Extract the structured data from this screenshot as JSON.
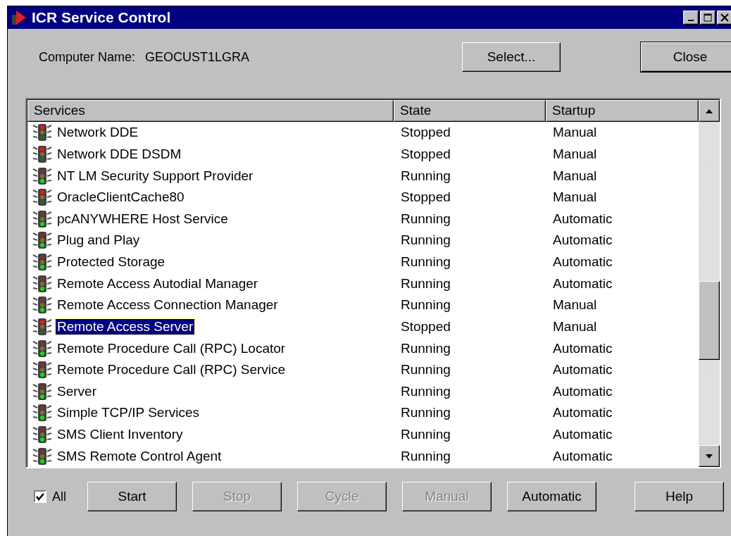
{
  "window": {
    "title": "ICR Service Control"
  },
  "computer": {
    "label": "Computer Name:",
    "value": "GEOCUST1LGRA"
  },
  "top_buttons": [
    {
      "label": "Select..."
    },
    {
      "label": "Close",
      "default": true
    }
  ],
  "table": {
    "columns": [
      "Services",
      "State",
      "Startup"
    ],
    "rows": [
      {
        "name": "Network DDE",
        "state": "Stopped",
        "startup": "Manual",
        "running": false,
        "selected": false
      },
      {
        "name": "Network DDE DSDM",
        "state": "Stopped",
        "startup": "Manual",
        "running": false,
        "selected": false
      },
      {
        "name": "NT LM Security Support Provider",
        "state": "Running",
        "startup": "Manual",
        "running": true,
        "selected": false
      },
      {
        "name": "OracleClientCache80",
        "state": "Stopped",
        "startup": "Manual",
        "running": false,
        "selected": false
      },
      {
        "name": "pcANYWHERE Host Service",
        "state": "Running",
        "startup": "Automatic",
        "running": true,
        "selected": false
      },
      {
        "name": "Plug and Play",
        "state": "Running",
        "startup": "Automatic",
        "running": true,
        "selected": false
      },
      {
        "name": "Protected Storage",
        "state": "Running",
        "startup": "Automatic",
        "running": true,
        "selected": false
      },
      {
        "name": "Remote Access Autodial Manager",
        "state": "Running",
        "startup": "Automatic",
        "running": true,
        "selected": false
      },
      {
        "name": "Remote Access Connection Manager",
        "state": "Running",
        "startup": "Manual",
        "running": true,
        "selected": false
      },
      {
        "name": "Remote Access Server",
        "state": "Stopped",
        "startup": "Manual",
        "running": false,
        "selected": true
      },
      {
        "name": "Remote Procedure Call (RPC) Locator",
        "state": "Running",
        "startup": "Automatic",
        "running": true,
        "selected": false
      },
      {
        "name": "Remote Procedure Call (RPC) Service",
        "state": "Running",
        "startup": "Automatic",
        "running": true,
        "selected": false
      },
      {
        "name": "Server",
        "state": "Running",
        "startup": "Automatic",
        "running": true,
        "selected": false
      },
      {
        "name": "Simple TCP/IP Services",
        "state": "Running",
        "startup": "Automatic",
        "running": true,
        "selected": false
      },
      {
        "name": "SMS Client Inventory",
        "state": "Running",
        "startup": "Automatic",
        "running": true,
        "selected": false
      },
      {
        "name": "SMS Remote Control Agent",
        "state": "Running",
        "startup": "Automatic",
        "running": true,
        "selected": false
      }
    ]
  },
  "all_checkbox": {
    "label": "All",
    "checked": true
  },
  "buttons": [
    {
      "label": "Start",
      "disabled": false
    },
    {
      "label": "Stop",
      "disabled": true
    },
    {
      "label": "Cycle",
      "disabled": true
    },
    {
      "label": "Manual",
      "disabled": true
    },
    {
      "label": "Automatic",
      "disabled": false
    },
    {
      "label": "Help",
      "disabled": false
    }
  ]
}
